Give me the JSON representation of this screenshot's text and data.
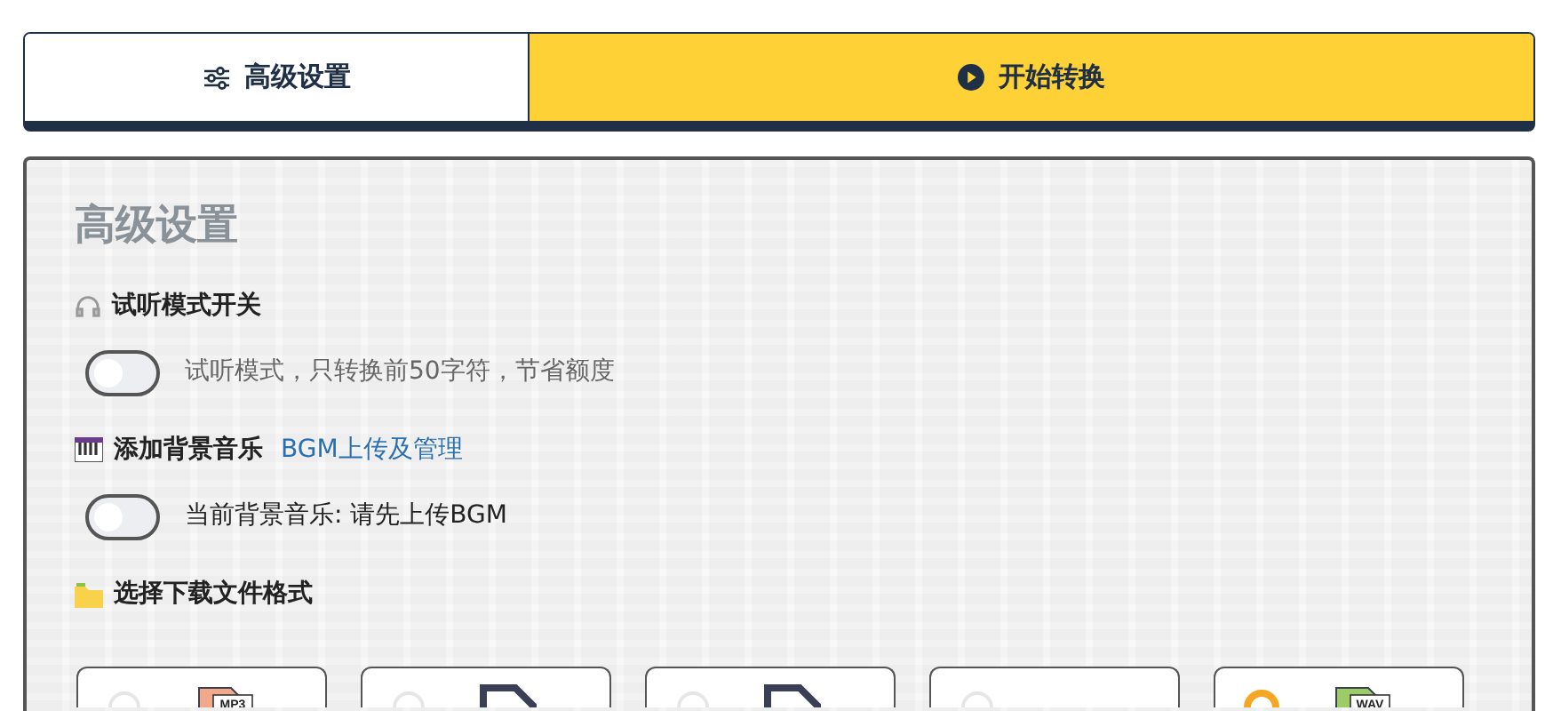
{
  "tabs": [
    {
      "label": "高级设置",
      "selected": false
    },
    {
      "label": "开始转换",
      "selected": true
    }
  ],
  "panel": {
    "title": "高级设置",
    "sections": [
      {
        "kind": "toggle",
        "heading": "试听模式开关",
        "toggle": {
          "on": false,
          "label": "试听模式，只转换前50字符，节省额度"
        }
      },
      {
        "kind": "toggle",
        "heading": "添加背景音乐",
        "link": "BGM上传及管理",
        "toggle": {
          "on": false,
          "label": "当前背景音乐: 请先上传BGM"
        }
      },
      {
        "kind": "formats",
        "heading": "选择下载文件格式",
        "formats": [
          {
            "selected": false,
            "badge": "MP3"
          },
          {
            "selected": false
          },
          {
            "selected": false
          },
          {
            "selected": false
          },
          {
            "selected": true,
            "badge": "WAV"
          }
        ]
      }
    ]
  }
}
